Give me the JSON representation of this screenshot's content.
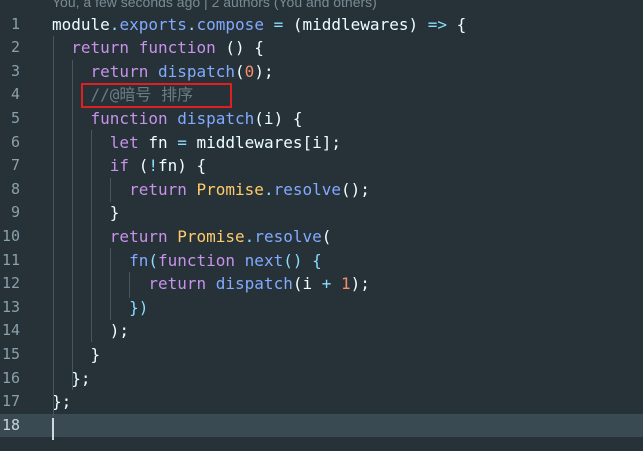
{
  "codelens": "You, a few seconds ago | 2 authors (You and others)",
  "colors": {
    "background": "#263238",
    "current_line": "#3a4a52",
    "keyword": "#c792ea",
    "function": "#82aaff",
    "class": "#ffcb6b",
    "number": "#f78c6c",
    "operator": "#89ddff",
    "comment": "#697d85",
    "plain": "#eeffff",
    "highlight_box": "#e02020"
  },
  "lines": [
    {
      "n": "1",
      "tokens": [
        [
          "plain",
          "module"
        ],
        [
          "operator",
          "."
        ],
        [
          "function",
          "exports"
        ],
        [
          "operator",
          "."
        ],
        [
          "function",
          "compose"
        ],
        [
          "plain",
          " "
        ],
        [
          "operator",
          "="
        ],
        [
          "plain",
          " ("
        ],
        [
          "plain",
          "middlewares"
        ],
        [
          "plain",
          ") "
        ],
        [
          "operator",
          "=>"
        ],
        [
          "plain",
          " {"
        ]
      ]
    },
    {
      "n": "2",
      "tokens": [
        [
          "plain",
          "  "
        ],
        [
          "keyword",
          "return"
        ],
        [
          "plain",
          " "
        ],
        [
          "keyword",
          "function"
        ],
        [
          "plain",
          " () {"
        ]
      ]
    },
    {
      "n": "3",
      "tokens": [
        [
          "plain",
          "    "
        ],
        [
          "keyword",
          "return"
        ],
        [
          "plain",
          " "
        ],
        [
          "function",
          "dispatch"
        ],
        [
          "plain",
          "("
        ],
        [
          "number",
          "0"
        ],
        [
          "plain",
          ");"
        ]
      ]
    },
    {
      "n": "4",
      "tokens": [
        [
          "plain",
          "    "
        ],
        [
          "comment",
          "//@暗号 排序"
        ]
      ]
    },
    {
      "n": "5",
      "tokens": [
        [
          "plain",
          "    "
        ],
        [
          "keyword",
          "function"
        ],
        [
          "plain",
          " "
        ],
        [
          "function",
          "dispatch"
        ],
        [
          "plain",
          "(i) {"
        ]
      ]
    },
    {
      "n": "6",
      "tokens": [
        [
          "plain",
          "      "
        ],
        [
          "keyword",
          "let"
        ],
        [
          "plain",
          " fn "
        ],
        [
          "operator",
          "="
        ],
        [
          "plain",
          " middlewares[i];"
        ]
      ]
    },
    {
      "n": "7",
      "tokens": [
        [
          "plain",
          "      "
        ],
        [
          "keyword",
          "if"
        ],
        [
          "plain",
          " ("
        ],
        [
          "operator",
          "!"
        ],
        [
          "plain",
          "fn) {"
        ]
      ]
    },
    {
      "n": "8",
      "tokens": [
        [
          "plain",
          "        "
        ],
        [
          "keyword",
          "return"
        ],
        [
          "plain",
          " "
        ],
        [
          "class",
          "Promise"
        ],
        [
          "operator",
          "."
        ],
        [
          "function",
          "resolve"
        ],
        [
          "plain",
          "();"
        ]
      ]
    },
    {
      "n": "9",
      "tokens": [
        [
          "plain",
          "      }"
        ]
      ]
    },
    {
      "n": "10",
      "tokens": [
        [
          "plain",
          "      "
        ],
        [
          "keyword",
          "return"
        ],
        [
          "plain",
          " "
        ],
        [
          "class",
          "Promise"
        ],
        [
          "operator",
          "."
        ],
        [
          "function",
          "resolve"
        ],
        [
          "plain",
          "("
        ]
      ]
    },
    {
      "n": "11",
      "tokens": [
        [
          "plain",
          "        "
        ],
        [
          "function",
          "fn"
        ],
        [
          "operator",
          "("
        ],
        [
          "keyword",
          "function"
        ],
        [
          "plain",
          " "
        ],
        [
          "function",
          "next"
        ],
        [
          "operator",
          "() {"
        ]
      ]
    },
    {
      "n": "12",
      "tokens": [
        [
          "plain",
          "          "
        ],
        [
          "keyword",
          "return"
        ],
        [
          "plain",
          " "
        ],
        [
          "function",
          "dispatch"
        ],
        [
          "plain",
          "(i "
        ],
        [
          "operator",
          "+"
        ],
        [
          "plain",
          " "
        ],
        [
          "number",
          "1"
        ],
        [
          "plain",
          ");"
        ]
      ]
    },
    {
      "n": "13",
      "tokens": [
        [
          "plain",
          "        "
        ],
        [
          "operator",
          "})"
        ]
      ]
    },
    {
      "n": "14",
      "tokens": [
        [
          "plain",
          "      );"
        ]
      ]
    },
    {
      "n": "15",
      "tokens": [
        [
          "plain",
          "    }"
        ]
      ]
    },
    {
      "n": "16",
      "tokens": [
        [
          "plain",
          "  };"
        ]
      ]
    },
    {
      "n": "17",
      "tokens": [
        [
          "plain",
          "};"
        ]
      ]
    },
    {
      "n": "18",
      "tokens": []
    }
  ]
}
